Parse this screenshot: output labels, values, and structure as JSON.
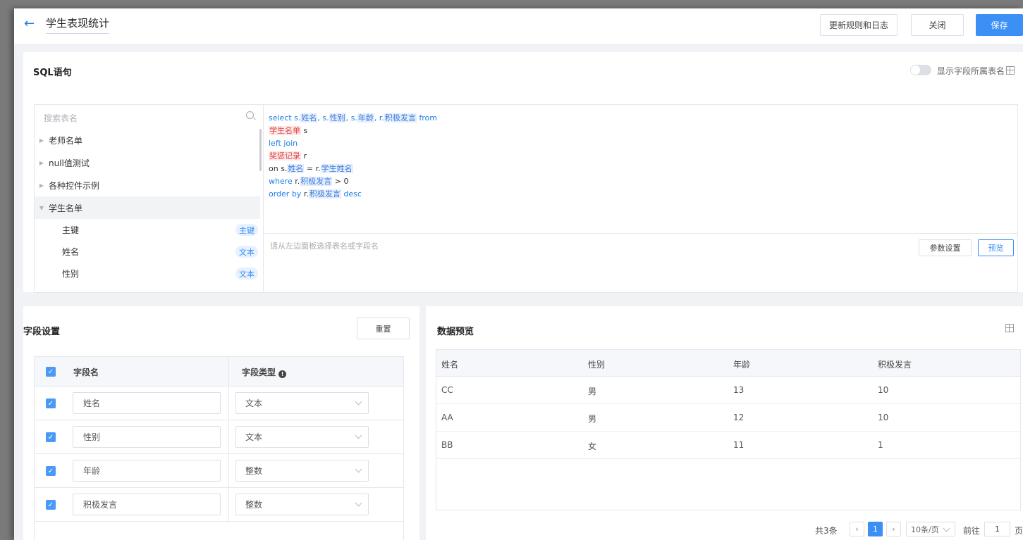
{
  "header": {
    "back_icon": "arrow-left-icon",
    "title": "学生表现统计",
    "buttons": {
      "update_rules": "更新规则和日志",
      "close": "关闭",
      "save": "保存"
    }
  },
  "sql": {
    "title": "SQL语句",
    "show_table_toggle_label": "显示字段所属表名",
    "search_placeholder": "搜索表名",
    "tables": [
      {
        "name": "老师名单",
        "expanded": false
      },
      {
        "name": "null值测试",
        "expanded": false
      },
      {
        "name": "各种控件示例",
        "expanded": false
      },
      {
        "name": "学生名单",
        "expanded": true
      }
    ],
    "fields": [
      {
        "name": "主键",
        "type": "主键"
      },
      {
        "name": "姓名",
        "type": "文本"
      },
      {
        "name": "性别",
        "type": "文本"
      }
    ],
    "code": {
      "l1_select": "select s.",
      "l1_f1": "姓名",
      "l1_s2": ", s.",
      "l1_f2": "性别",
      "l1_s3": ", s.",
      "l1_f3": "年龄",
      "l1_s4": ", r.",
      "l1_f4": "积极发言",
      "l1_from": " from",
      "l2_table": "学生名单",
      "l2_alias": " s",
      "l3": "left join",
      "l4_table": "奖惩记录",
      "l4_alias": " r",
      "l5_on": "on s.",
      "l5_f1": "姓名",
      "l5_eq": " = r.",
      "l5_f2": "学生姓名",
      "l6_where": "where",
      "l6_r": " r.",
      "l6_f": "积极发言",
      "l6_cond": " > 0",
      "l7_order": "order by",
      "l7_r": " r.",
      "l7_f": "积极发言",
      "l7_desc": " desc"
    },
    "hint": "请从左边面板选择表名或字段名",
    "param_button": "参数设置",
    "preview_button": "预览"
  },
  "field_settings": {
    "title": "字段设置",
    "reset_button": "重置",
    "col_name": "字段名",
    "col_type": "字段类型",
    "rows": [
      {
        "name": "姓名",
        "type": "文本",
        "checked": true
      },
      {
        "name": "性别",
        "type": "文本",
        "checked": true
      },
      {
        "name": "年龄",
        "type": "整数",
        "checked": true
      },
      {
        "name": "积极发言",
        "type": "整数",
        "checked": true
      }
    ]
  },
  "preview": {
    "title": "数据预览",
    "columns": [
      "姓名",
      "性别",
      "年龄",
      "积极发言"
    ],
    "rows": [
      [
        "CC",
        "男",
        "13",
        "10"
      ],
      [
        "AA",
        "男",
        "12",
        "10"
      ],
      [
        "BB",
        "女",
        "11",
        "1"
      ]
    ],
    "pagination": {
      "total": "共3条",
      "prev": "‹",
      "current_page": "1",
      "next": "›",
      "page_size": "10条/页",
      "goto_label": "前往",
      "goto_value": "1",
      "page_suffix": "页"
    }
  },
  "colors": {
    "primary": "#3c8ff5",
    "table_tag": "#e04545",
    "field_tag": "#3a7ce0"
  }
}
